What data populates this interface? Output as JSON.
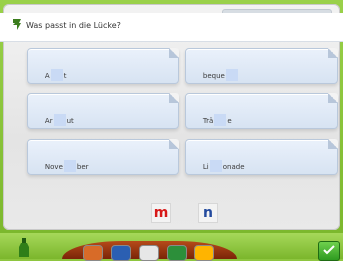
{
  "question": "Was passt in die Lücke?",
  "cards": [
    {
      "left": "A",
      "right": "t"
    },
    {
      "left": "beque",
      "right": ""
    },
    {
      "left": "Ar",
      "right": "ut"
    },
    {
      "left": "Trä",
      "right": "e"
    },
    {
      "left": "Nove",
      "right": "ber"
    },
    {
      "left": "Li",
      "right": "onade"
    }
  ],
  "letters": [
    {
      "text": "m",
      "color": "#d71919"
    },
    {
      "text": "n",
      "color": "#234a9e"
    }
  ],
  "toolbar": {
    "icons": [
      "flower-icon",
      "keyboard-icon",
      "help-icon",
      "sound-icon",
      "book-icon"
    ],
    "check_icon": "check-icon"
  },
  "colors": {
    "frame": "#8ec63f",
    "card": "#dbe6f4",
    "gap": "#c9daf5",
    "tray": "#a53d14"
  }
}
